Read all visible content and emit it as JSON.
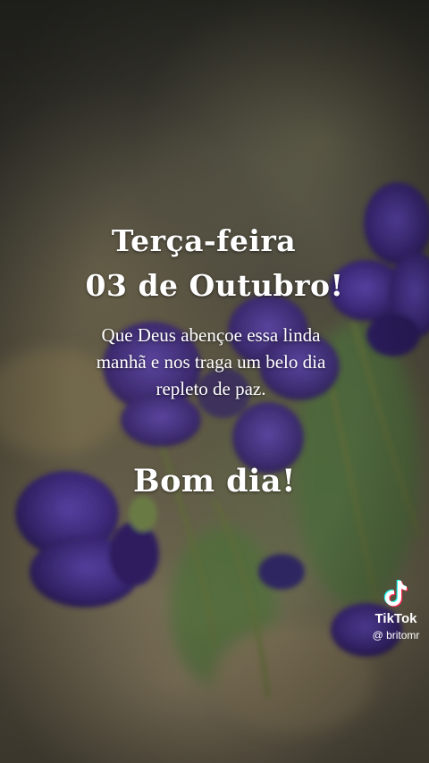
{
  "card": {
    "day": "Terça-feira",
    "date": "03 de Outubro!",
    "message": "Que Deus  abençoe essa linda manhã e nos traga um belo dia repleto de paz.",
    "greeting": "Bom dia!"
  },
  "watermark": {
    "brand": "TikTok",
    "handle": "@ britomr",
    "icon": "tiktok-note-icon"
  },
  "colors": {
    "text": "#ffffff",
    "flower": "#3d2a7a"
  }
}
